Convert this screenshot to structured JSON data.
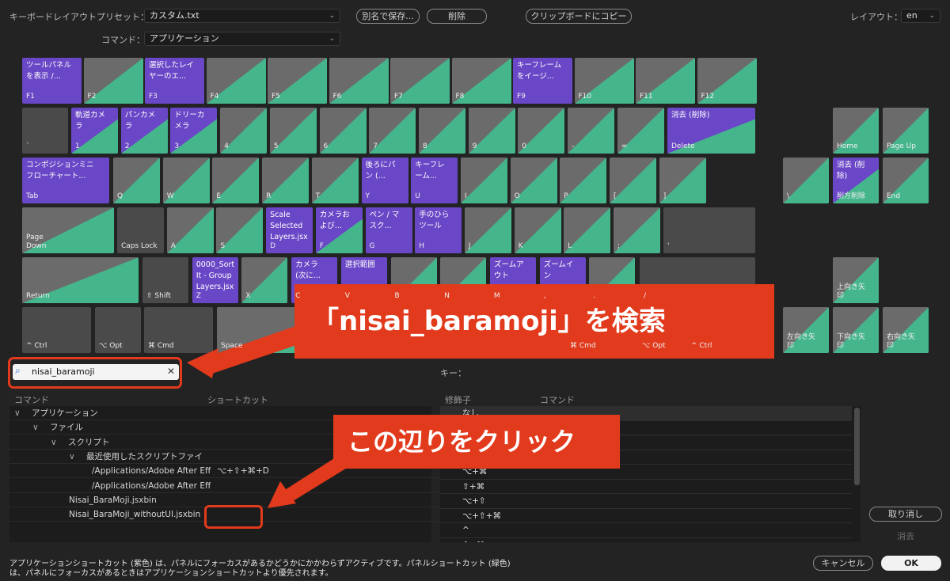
{
  "header": {
    "preset_label": "キーボードレイアウトプリセット：",
    "preset_value": "カスタム.txt",
    "save_as": "別名で保存...",
    "delete": "削除",
    "copy_clipboard": "クリップボードにコピー",
    "layout_label": "レイアウト：",
    "layout_value": "en",
    "command_label": "コマンド：",
    "command_value": "アプリケーション"
  },
  "keys": [
    {
      "label": "F1",
      "cmd": "ツールパネル\nを表示 /...",
      "type": "app"
    },
    {
      "label": "F2",
      "cmd": "",
      "type": "split"
    },
    {
      "label": "F3",
      "cmd": "選択したレイ\nヤーのエ...",
      "type": "app"
    },
    {
      "label": "F4",
      "cmd": "",
      "type": "split"
    },
    {
      "label": "F5",
      "cmd": "",
      "type": "split"
    },
    {
      "label": "F6",
      "cmd": "",
      "type": "split"
    },
    {
      "label": "F7",
      "cmd": "",
      "type": "split"
    },
    {
      "label": "F8",
      "cmd": "",
      "type": "split"
    },
    {
      "label": "F9",
      "cmd": "キーフレーム\nをイージ...",
      "type": "app"
    },
    {
      "label": "F10",
      "cmd": "",
      "type": "split"
    },
    {
      "label": "F11",
      "cmd": "",
      "type": "split"
    },
    {
      "label": "F12",
      "cmd": "",
      "type": "split"
    },
    {
      "label": "`",
      "cmd": "",
      "type": "gray"
    },
    {
      "label": "1",
      "cmd": "軌道カメ\nラ",
      "type": "app2"
    },
    {
      "label": "2",
      "cmd": "パンカメ\nラ",
      "type": "app2"
    },
    {
      "label": "3",
      "cmd": "ドリーカ\nメラ",
      "type": "app2"
    },
    {
      "label": "4",
      "cmd": "",
      "type": "split"
    },
    {
      "label": "5",
      "cmd": "",
      "type": "split"
    },
    {
      "label": "6",
      "cmd": "",
      "type": "split"
    },
    {
      "label": "7",
      "cmd": "",
      "type": "split"
    },
    {
      "label": "8",
      "cmd": "",
      "type": "split"
    },
    {
      "label": "9",
      "cmd": "",
      "type": "split"
    },
    {
      "label": "0",
      "cmd": "",
      "type": "split"
    },
    {
      "label": "-",
      "cmd": "",
      "type": "split"
    },
    {
      "label": "=",
      "cmd": "",
      "type": "split"
    },
    {
      "label": "Delete",
      "cmd": "消去 (削除)",
      "type": "app2"
    },
    {
      "label": "Home",
      "cmd": "",
      "type": "split"
    },
    {
      "label": "Page Up",
      "cmd": "",
      "type": "split"
    },
    {
      "label": "Tab",
      "cmd": "コンポジションミニ\nフローチャート...",
      "type": "app"
    },
    {
      "label": "Q",
      "cmd": "",
      "type": "split"
    },
    {
      "label": "W",
      "cmd": "",
      "type": "split"
    },
    {
      "label": "E",
      "cmd": "",
      "type": "split"
    },
    {
      "label": "R",
      "cmd": "",
      "type": "split"
    },
    {
      "label": "T",
      "cmd": "",
      "type": "split"
    },
    {
      "label": "Y",
      "cmd": "後ろにパ\nン (...",
      "type": "app"
    },
    {
      "label": "U",
      "cmd": "キーフレ\nーム...",
      "type": "app"
    },
    {
      "label": "I",
      "cmd": "",
      "type": "split"
    },
    {
      "label": "O",
      "cmd": "",
      "type": "split"
    },
    {
      "label": "P",
      "cmd": "",
      "type": "split"
    },
    {
      "label": "[",
      "cmd": "",
      "type": "split"
    },
    {
      "label": "]",
      "cmd": "",
      "type": "split"
    },
    {
      "label": "\\",
      "cmd": "",
      "type": "split"
    },
    {
      "label": "削方削除",
      "cmd": "消去 (削\n除)",
      "type": "app2"
    },
    {
      "label": "End",
      "cmd": "",
      "type": "split"
    },
    {
      "label": "Page\nDown",
      "cmd": "",
      "type": "split"
    },
    {
      "label": "Caps Lock",
      "cmd": "",
      "type": "gray"
    },
    {
      "label": "A",
      "cmd": "",
      "type": "split"
    },
    {
      "label": "S",
      "cmd": "",
      "type": "split"
    },
    {
      "label": "D",
      "cmd": "Scale\nSelected\nLayers.jsx",
      "type": "app"
    },
    {
      "label": "F",
      "cmd": "カメラお\nよび...",
      "type": "app2"
    },
    {
      "label": "G",
      "cmd": "ペン / マ\nスク...",
      "type": "app"
    },
    {
      "label": "H",
      "cmd": "手のひら\nツール",
      "type": "app"
    },
    {
      "label": "J",
      "cmd": "",
      "type": "split"
    },
    {
      "label": "K",
      "cmd": "",
      "type": "split"
    },
    {
      "label": "L",
      "cmd": "",
      "type": "split"
    },
    {
      "label": ";",
      "cmd": "",
      "type": "split"
    },
    {
      "label": "'",
      "cmd": "",
      "type": "gray"
    },
    {
      "label": "Return",
      "cmd": "",
      "type": "split"
    },
    {
      "label": "⇧ Shift",
      "cmd": "",
      "type": "gray"
    },
    {
      "label": "Z",
      "cmd": "0000_Sort\nIt - Group\nLayers.jsx",
      "type": "app"
    },
    {
      "label": "X",
      "cmd": "",
      "type": "split"
    },
    {
      "label": "C",
      "cmd": "カメラ\n(次に...",
      "type": "app"
    },
    {
      "label": "V",
      "cmd": "選択範囲",
      "type": "app"
    },
    {
      "label": "B",
      "cmd": "",
      "type": "split"
    },
    {
      "label": "N",
      "cmd": "",
      "type": "split"
    },
    {
      "label": "M",
      "cmd": "ズームア\nウト",
      "type": "app"
    },
    {
      "label": ",",
      "cmd": "ズームイ\nン",
      "type": "app"
    },
    {
      "label": ".",
      "cmd": "",
      "type": "split"
    },
    {
      "label": "/",
      "cmd": "",
      "type": "gray"
    },
    {
      "label": "上向き矢\n印",
      "cmd": "",
      "type": "split"
    },
    {
      "label": "^ Ctrl",
      "cmd": "",
      "type": "gray"
    },
    {
      "label": "⌥ Opt",
      "cmd": "",
      "type": "gray"
    },
    {
      "label": "⌘ Cmd",
      "cmd": "",
      "type": "gray"
    },
    {
      "label": "Space",
      "cmd": "",
      "type": "split"
    },
    {
      "label": "⌘ Cmd",
      "cmd": "",
      "type": "gray"
    },
    {
      "label": "⌥ Opt",
      "cmd": "",
      "type": "gray"
    },
    {
      "label": "^ Ctrl",
      "cmd": "",
      "type": "gray"
    },
    {
      "label": "左向き矢\n印",
      "cmd": "",
      "type": "split"
    },
    {
      "label": "下向き矢\n印",
      "cmd": "",
      "type": "split"
    },
    {
      "label": "右向き矢\n印",
      "cmd": "",
      "type": "split"
    }
  ],
  "search": {
    "value": "nisai_baramoji",
    "key_label": "キー："
  },
  "tree": {
    "col_command": "コマンド",
    "col_shortcut": "ショートカット",
    "rows": [
      {
        "text": "アプリケーション",
        "arrow": "∨",
        "indent": 0,
        "shortcut": ""
      },
      {
        "text": "ファイル",
        "arrow": "∨",
        "indent": 1,
        "shortcut": ""
      },
      {
        "text": "スクリプト",
        "arrow": "∨",
        "indent": 2,
        "shortcut": ""
      },
      {
        "text": "最近使用したスクリプトファイ",
        "arrow": "∨",
        "indent": 3,
        "shortcut": ""
      },
      {
        "text": "/Applications/Adobe After Eff",
        "arrow": "",
        "indent": 4,
        "shortcut": "⌥+⇧+⌘+D"
      },
      {
        "text": "/Applications/Adobe After Eff",
        "arrow": "",
        "indent": 4,
        "shortcut": ""
      },
      {
        "text": "Nisai_BaraMoji.jsxbin",
        "arrow": "",
        "indent": 3,
        "shortcut": ""
      },
      {
        "text": "Nisai_BaraMoji_withoutUI.jsxbin",
        "arrow": "",
        "indent": 3,
        "shortcut": ""
      }
    ]
  },
  "modifiers": {
    "col_modifier": "修飾子",
    "col_command": "コマンド",
    "rows": [
      "なし",
      "",
      "",
      "",
      "⌥+⌘",
      "⇧+⌘",
      "⌥+⇧",
      "⌥+⇧+⌘",
      "^",
      "^+⌘"
    ]
  },
  "callouts": {
    "search_text": "「nisai_baramoji」を検索",
    "click_text": "この辺りをクリック"
  },
  "footer": {
    "note_line1": "アプリケーションショートカット (紫色) は、パネルにフォーカスがあるかどうかにかかわらずアクティブです。パネルショートカット (緑色)",
    "note_line2": "は、パネルにフォーカスがあるときはアプリケーションショートカットより優先されます。",
    "undo": "取り消し",
    "clear": "消去",
    "cancel": "キャンセル",
    "ok": "OK"
  },
  "colors": {
    "app_purple": "#6a47c6",
    "panel_green": "#45b58c",
    "key_gray": "#6b6b6b",
    "callout_red": "#e23a1c"
  }
}
